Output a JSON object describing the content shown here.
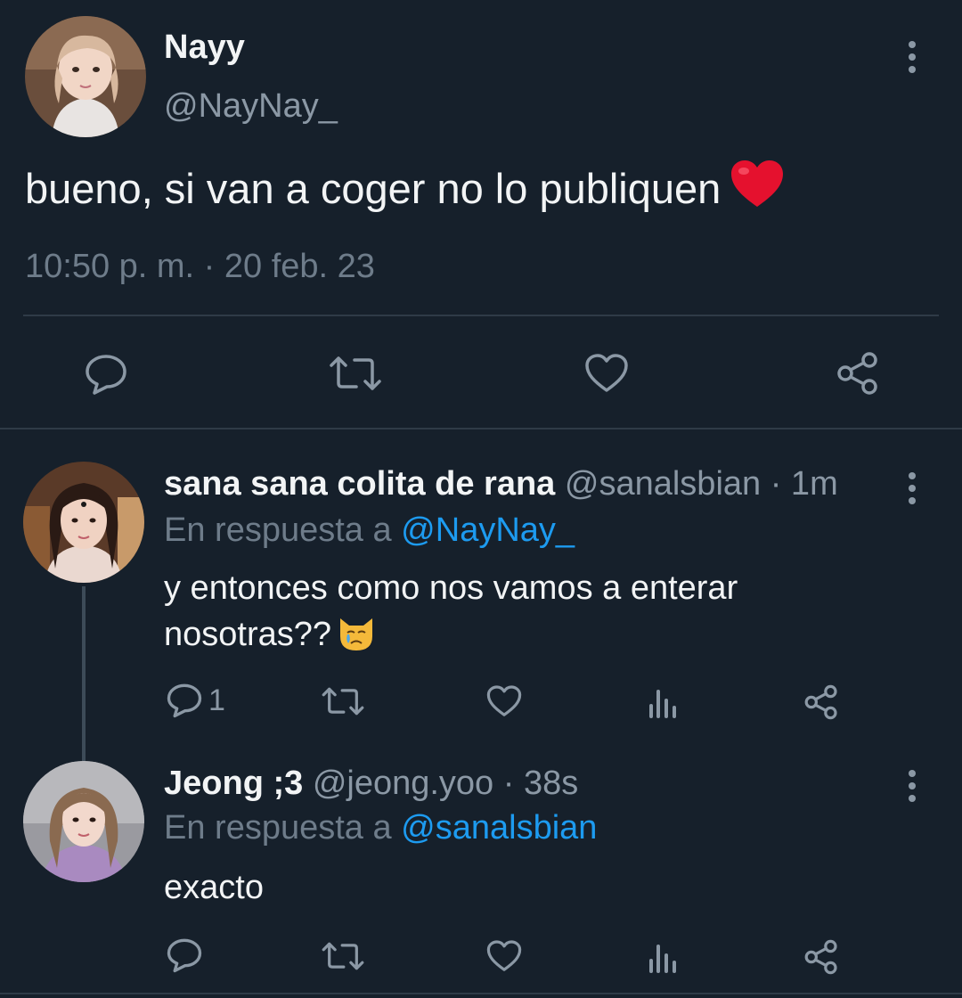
{
  "main_tweet": {
    "author_name": "Nayy",
    "author_handle": "@NayNay_",
    "text": "bueno, si van a coger no lo publiquen",
    "emoji": "red-heart",
    "timestamp": "10:50 p. m. · 20 feb. 23",
    "actions": [
      "reply-icon",
      "retweet-icon",
      "like-icon",
      "share-icon"
    ]
  },
  "replies": [
    {
      "author_name": "sana sana colita de rana",
      "author_handle": "@sanalsbian",
      "time": "· 1m",
      "reply_prefix": "En respuesta a",
      "reply_to": "@NayNay_",
      "text_line1": "y entonces como nos vamos a enterar",
      "text_line2": "nosotras??",
      "emoji": "crying-cat-face",
      "reply_count": "1"
    },
    {
      "author_name": "Jeong ;3",
      "author_handle": "@jeong.yoo",
      "time": "· 38s",
      "reply_prefix": "En respuesta a",
      "reply_to": "@sanalsbian",
      "text_line1": "exacto",
      "reply_count": ""
    }
  ],
  "colors": {
    "background": "#16202b",
    "text_primary": "#f2f4f5",
    "text_secondary": "#8b98a5",
    "link": "#1d9bf0",
    "divider": "#2f3b47"
  }
}
